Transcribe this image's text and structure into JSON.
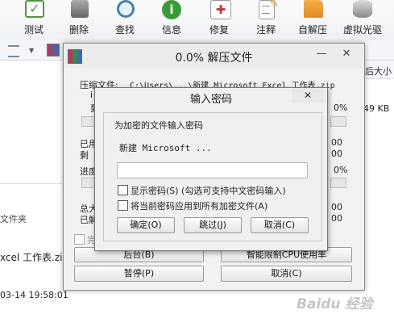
{
  "toolbar": {
    "items": [
      {
        "label": "测试",
        "icon": "test-icon",
        "color": "#4a9a3a"
      },
      {
        "label": "删除",
        "icon": "trash-icon",
        "color": "#7a7a7a"
      },
      {
        "label": "查找",
        "icon": "search-icon",
        "color": "#4a7fb0"
      },
      {
        "label": "信息",
        "icon": "info-icon",
        "color": "#3a9a3a"
      },
      {
        "label": "修复",
        "icon": "repair-kit-icon",
        "color": "#c03a3a"
      },
      {
        "label": "注释",
        "icon": "comment-icon",
        "color": "#d8a030"
      },
      {
        "label": "自解压",
        "icon": "self-extract-icon",
        "color": "#e08a2a"
      },
      {
        "label": "虚拟光驱",
        "icon": "virtual-drive-icon",
        "color": "#8a8a8a"
      }
    ]
  },
  "background": {
    "column_header": "后大小",
    "size_value": "49 KB",
    "left_label": "文件夹",
    "filename": "xcel 工作表.zip",
    "datetime": "03-14 19:58:01"
  },
  "extract_window": {
    "title": "0.0% 解压文件",
    "compress_label": "压缩文件:",
    "compress_path": "C:\\Users\\...\\新建 Microsoft Excel 工作表.zip",
    "row1_fragment": "i",
    "row2_fragment": "到",
    "pct1": "0%",
    "pct2": "0%",
    "elapsed_label": "已用",
    "remaining_label": "剩",
    "progress_label": "进度",
    "elapsed_value": "00",
    "remaining_value": "00",
    "total_label": "总大",
    "done_label": "已解",
    "total_value": "00",
    "done_value": "00",
    "checkbox_label": "完",
    "background_button": "后台(B)",
    "smart_button": "智能限制CPU使用率",
    "pause_button": "暂停(P)",
    "cancel_button": "取消(C)"
  },
  "password_dialog": {
    "title": "输入密码",
    "group_title": "为加密的文件输入密码",
    "file_name": "新建 Microsoft ...",
    "password_value": "",
    "show_password_label": "显示密码(S) (勾选可支持中文密码输入)",
    "apply_all_label": "将当前密码应用到所有加密文件(A)",
    "ok_button": "确定(O)",
    "skip_button": "跳过(J)",
    "cancel_button": "取消(C)"
  },
  "watermark": "Baidu 经验"
}
